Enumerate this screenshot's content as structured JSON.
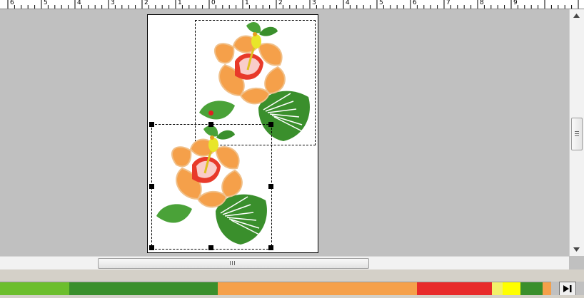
{
  "ruler": {
    "labels": [
      "6",
      "5",
      "4",
      "3",
      "2",
      "1",
      "0",
      "1",
      "2",
      "3",
      "4",
      "5",
      "6",
      "7",
      "8",
      "9"
    ]
  },
  "colors": {
    "canvas_bg": "#c0c0c0",
    "page_bg": "#ffffff",
    "handle": "#000000",
    "flower_orange": "#f5a04a",
    "flower_red": "#e83a2a",
    "leaf_green": "#3a8f2c",
    "pistil_yellow": "#e8e62a"
  },
  "color_sequence": [
    {
      "name": "light-green",
      "color": "#6cbe2d",
      "fraction": 0.125
    },
    {
      "name": "dark-green",
      "color": "#3a8f2c",
      "fraction": 0.27
    },
    {
      "name": "orange",
      "color": "#f5a04a",
      "fraction": 0.362
    },
    {
      "name": "red",
      "color": "#e82a2a",
      "fraction": 0.135
    },
    {
      "name": "pale-yellow",
      "color": "#f2f06a",
      "fraction": 0.02
    },
    {
      "name": "yellow",
      "color": "#ffff00",
      "fraction": 0.032
    },
    {
      "name": "green",
      "color": "#3a8f2c",
      "fraction": 0.04
    },
    {
      "name": "orange-end",
      "color": "#f5a04a",
      "fraction": 0.016
    }
  ],
  "icons": {
    "scroll_up": "triangle-up",
    "scroll_down": "triangle-down",
    "play_end": "play-to-end"
  }
}
